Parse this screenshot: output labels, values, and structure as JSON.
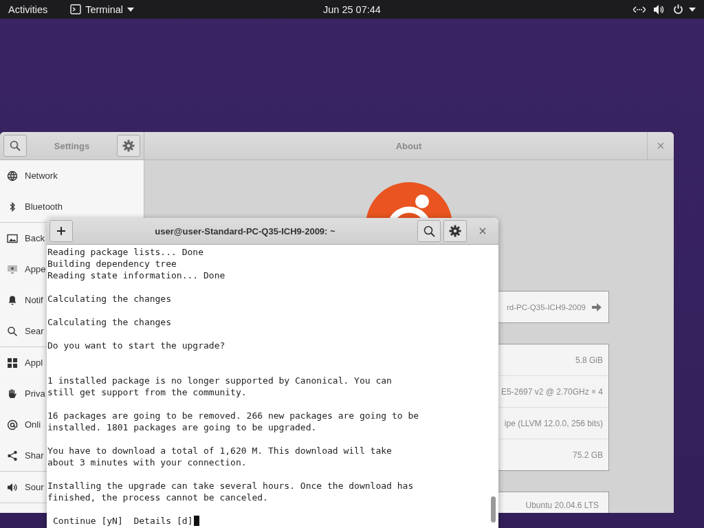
{
  "top_bar": {
    "activities": "Activities",
    "app_menu": "Terminal",
    "clock": "Jun 25  07:44"
  },
  "settings_window": {
    "sidebar_title": "Settings",
    "panel_title": "About",
    "sidebar_groups": [
      [
        {
          "label": "Network"
        },
        {
          "label": "Bluetooth"
        }
      ],
      [
        {
          "label": "Back"
        },
        {
          "label": "Appe"
        },
        {
          "label": "Notif"
        },
        {
          "label": "Sear"
        }
      ],
      [
        {
          "label": "Appl"
        },
        {
          "label": "Priva"
        },
        {
          "label": "Onli"
        },
        {
          "label": "Shar"
        }
      ],
      [
        {
          "label": "Sour"
        }
      ]
    ],
    "device_name": "rd-PC-Q35-ICH9-2009",
    "hardware_values": [
      "5.8 GiB",
      "E5-2697 v2 @ 2.70GHz × 4",
      "ipe (LLVM 12.0.0, 256 bits)",
      "75.2 GB"
    ],
    "os_value": "Ubuntu 20.04.6 LTS"
  },
  "terminal_window": {
    "title": "user@user-Standard-PC-Q35-ICH9-2009: ~",
    "paragraphs": [
      {
        "kind": "output",
        "lines": [
          "Reading package lists... Done",
          "Building dependency tree",
          "Reading state information... Done"
        ]
      },
      {
        "kind": "output",
        "lines": [
          "Calculating the changes"
        ]
      },
      {
        "kind": "output",
        "lines": [
          "Calculating the changes"
        ]
      },
      {
        "kind": "question",
        "lines": [
          "Do you want to start the upgrade?"
        ]
      },
      {
        "kind": "output",
        "lines": [
          "1 installed package is no longer supported by Canonical. You can",
          "still get support from the community."
        ]
      },
      {
        "kind": "output",
        "lines": [
          "16 packages are going to be removed. 266 new packages are going to be",
          "installed. 1801 packages are going to be upgraded."
        ]
      },
      {
        "kind": "output",
        "lines": [
          "You have to download a total of 1,620 M. This download will take",
          "about 3 minutes with your connection."
        ]
      },
      {
        "kind": "output",
        "lines": [
          "Installing the upgrade can take several hours. Once the download has",
          "finished, the process cannot be canceled."
        ]
      }
    ],
    "prompt": "Continue [yN]  Details [d]"
  }
}
